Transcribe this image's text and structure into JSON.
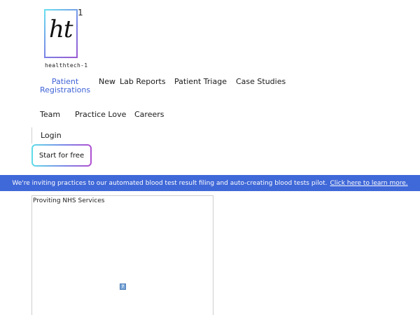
{
  "logo": {
    "mark": "ht",
    "superscript": "1",
    "caption": "healthtech-1"
  },
  "nav": {
    "patient_registrations_line1": "Patient",
    "patient_registrations_line2": "Registrations",
    "new": "New",
    "lab_reports": "Lab Reports",
    "patient_triage": "Patient Triage",
    "case_studies": "Case Studies",
    "team": "Team",
    "practice_love": "Practice Love",
    "careers": "Careers",
    "login": "Login",
    "cta": "Start for free"
  },
  "banner": {
    "text": "We're inviting practices to our automated blood test result filing and auto-creating blood tests pilot.",
    "link": "Click here to learn more."
  },
  "frame": {
    "title": "Proviting NHS Services",
    "broken_image_glyph": "?"
  },
  "colors": {
    "accent": "#3f63d6",
    "banner_bg": "#3f68d8",
    "cta_gradient_start": "#5fdce8",
    "cta_gradient_end": "#b04fd0"
  }
}
